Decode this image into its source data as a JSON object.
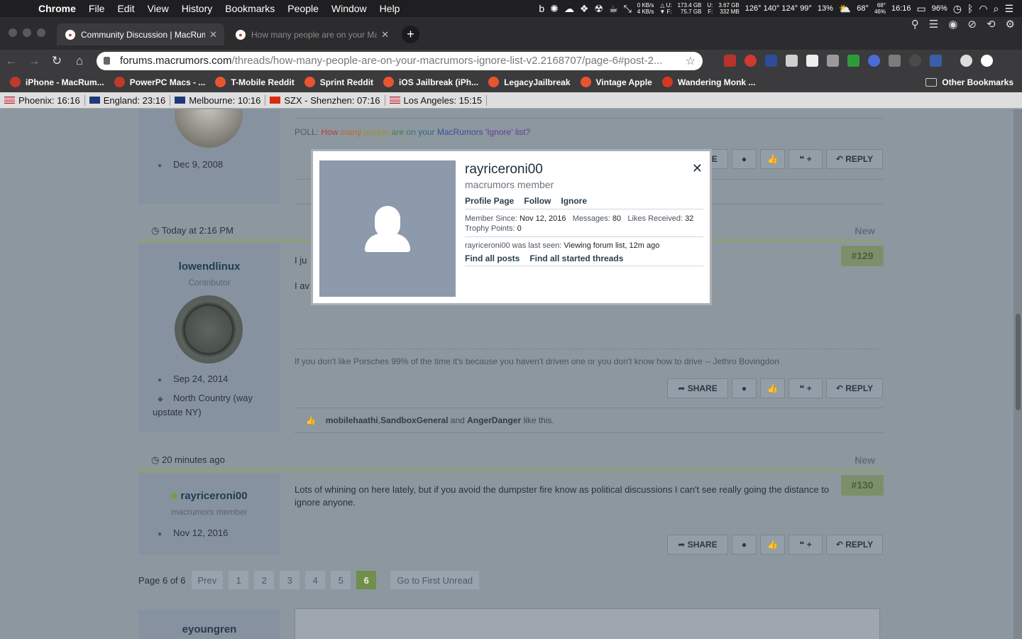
{
  "menubar": {
    "app": "Chrome",
    "items": [
      "File",
      "Edit",
      "View",
      "History",
      "Bookmarks",
      "People",
      "Window",
      "Help"
    ],
    "net_up": "0 KB/s",
    "net_down": "4 KB/s",
    "disk1_u": "U:",
    "disk1_f": "F:",
    "disk1_used": "173.4 GB",
    "disk1_free": "75.7 GB",
    "disk2_u": "U:",
    "disk2_f": "F:",
    "disk2_used": "3.67 GB",
    "disk2_free": "332 MB",
    "temps": "126° 140° 124° 99°",
    "cpu": "13%",
    "weather": "68°",
    "weather_hi": "68°",
    "weather_lo": "46%",
    "time": "16:16",
    "battery": "96%"
  },
  "tabs": {
    "active": "Community Discussion | MacRumors",
    "inactive": "How many people are on your MacRumors"
  },
  "omnibox": {
    "host": "forums.macrumors.com",
    "path": "/threads/how-many-people-are-on-your-macrumors-ignore-list-v2.2168707/page-6#post-2..."
  },
  "bookmarks": [
    {
      "label": "iPhone - MacRum...",
      "color": "#c0392b"
    },
    {
      "label": "PowerPC Macs - ...",
      "color": "#c0392b"
    },
    {
      "label": "T-Mobile Reddit",
      "color": "#e8552d"
    },
    {
      "label": "Sprint Reddit",
      "color": "#e8552d"
    },
    {
      "label": "iOS Jailbreak (iPh...",
      "color": "#e8552d"
    },
    {
      "label": "LegacyJailbreak",
      "color": "#e8552d"
    },
    {
      "label": "Vintage Apple",
      "color": "#e8552d"
    },
    {
      "label": "Wandering Monk ...",
      "color": "#d33a1f"
    }
  ],
  "other_bookmarks": "Other Bookmarks",
  "clocks": [
    {
      "label": "Phoenix: 16:16"
    },
    {
      "label": "England: 23:16"
    },
    {
      "label": "Melbourne: 10:16"
    },
    {
      "label": "SZX - Shenzhen: 07:16"
    },
    {
      "label": "Los Angeles: 15:15"
    }
  ],
  "post_top": {
    "joined": "Dec 9, 2008",
    "poll": {
      "prefix": "POLL: ",
      "words": [
        "How",
        "many",
        "people",
        "are",
        "on",
        "your",
        "MacRumors",
        "'Ignore' list?"
      ]
    }
  },
  "post129": {
    "date": "Today at 2:16 PM",
    "new_label": "New",
    "number": "#129",
    "username": "lowendlinux",
    "usertitle": "Contributor",
    "joined": "Sep 24, 2014",
    "location": "North Country (way upstate NY)",
    "text1": "I ju",
    "text2": "I av",
    "signature": "If you don't like Porsches 99% of the time it's because you haven't driven one or you don't know how to drive -- Jethro Bovingdon",
    "likes": {
      "users": [
        "mobilehaathi",
        "SandboxGeneral",
        "AngerDanger"
      ],
      "sep1": ", ",
      "sep2": " and ",
      "suffix": " like this."
    }
  },
  "post130": {
    "date": "20 minutes ago",
    "new_label": "New",
    "number": "#130",
    "username": "rayriceroni00",
    "usertitle": "macrumors member",
    "joined": "Nov 12, 2016",
    "text": "Lots of whining on here lately, but if you avoid the dumpster fire know as political discussions I can't see really going the distance to ignore anyone."
  },
  "actions": {
    "share": "SHARE",
    "quote": "+",
    "reply": "REPLY"
  },
  "pagination": {
    "summary": "Page 6 of 6",
    "prev": "Prev",
    "pages": [
      "1",
      "2",
      "3",
      "4",
      "5",
      "6"
    ],
    "current": "6",
    "first_unread": "Go to First Unread"
  },
  "next_post": {
    "username": "eyoungren"
  },
  "member_card": {
    "name": "rayriceroni00",
    "title": "macrumors member",
    "links": [
      "Profile Page",
      "Follow",
      "Ignore"
    ],
    "member_since_label": "Member Since:",
    "member_since": "Nov 12, 2016",
    "messages_label": "Messages:",
    "messages": "80",
    "likes_label": "Likes Received:",
    "likes": "32",
    "trophy_label": "Trophy Points:",
    "trophy": "0",
    "last_seen_prefix": "rayriceroni00 was last seen:",
    "last_seen": "Viewing forum list, 12m ago",
    "find_links": [
      "Find all posts",
      "Find all started threads"
    ]
  }
}
